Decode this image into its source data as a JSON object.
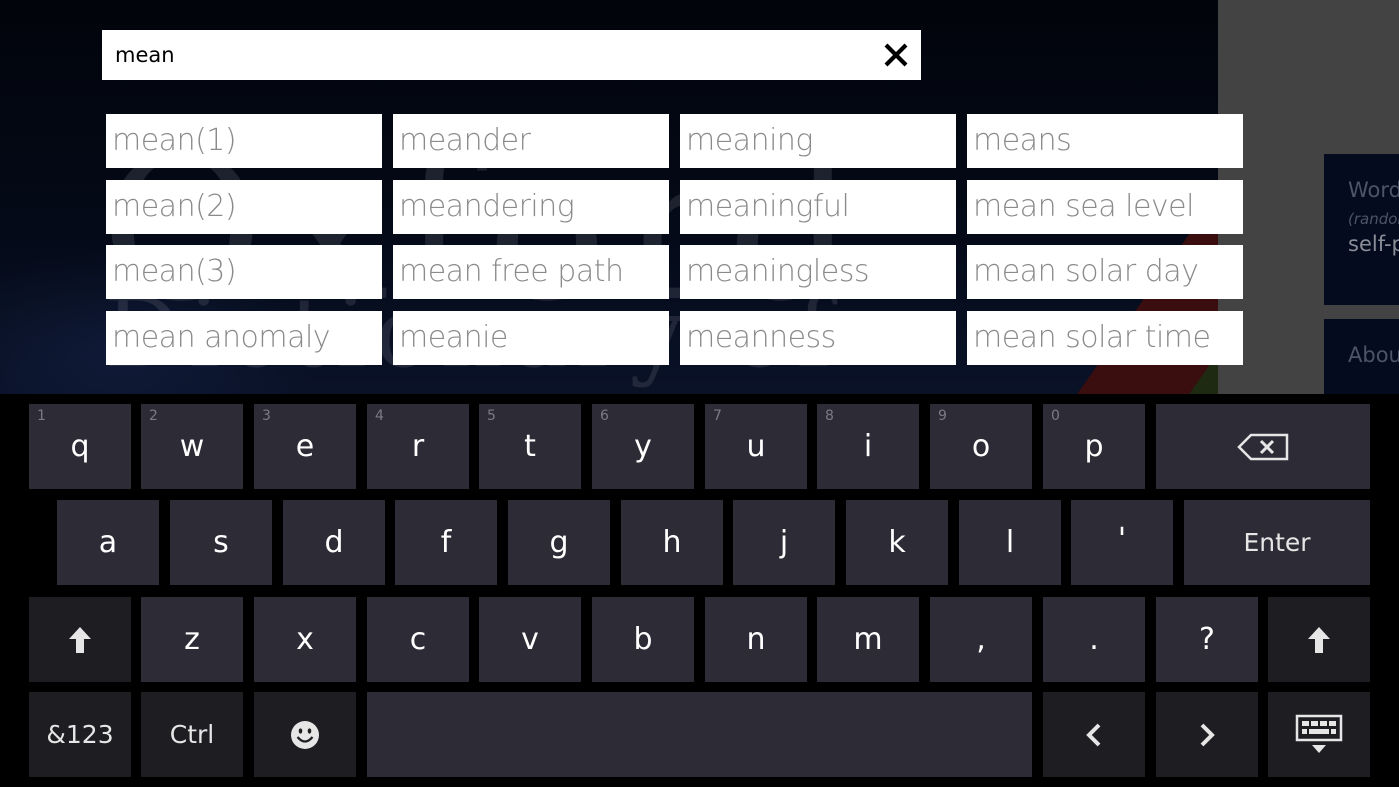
{
  "background": {
    "watermark_line1": "Oxford",
    "watermark_line2": "Dictionary of"
  },
  "side_panel": {
    "word_tile": {
      "title": "Word",
      "subtitle": "(random)",
      "word": "self-p"
    },
    "about_tile": {
      "title": "About"
    }
  },
  "search": {
    "value": "mean",
    "placeholder": "",
    "clear_icon": "close-icon"
  },
  "suggestions": [
    [
      "mean(1)",
      "meander",
      "meaning",
      "means"
    ],
    [
      "mean(2)",
      "meandering",
      "meaningful",
      "mean sea level"
    ],
    [
      "mean(3)",
      "mean free path",
      "meaningless",
      "mean solar day"
    ],
    [
      "mean anomaly",
      "meanie",
      "meanness",
      "mean solar time"
    ]
  ],
  "keyboard": {
    "row1": [
      {
        "label": "q",
        "hint": "1"
      },
      {
        "label": "w",
        "hint": "2"
      },
      {
        "label": "e",
        "hint": "3"
      },
      {
        "label": "r",
        "hint": "4"
      },
      {
        "label": "t",
        "hint": "5"
      },
      {
        "label": "y",
        "hint": "6"
      },
      {
        "label": "u",
        "hint": "7"
      },
      {
        "label": "i",
        "hint": "8"
      },
      {
        "label": "o",
        "hint": "9"
      },
      {
        "label": "p",
        "hint": "0"
      }
    ],
    "backspace_icon": "backspace-icon",
    "row2": [
      "a",
      "s",
      "d",
      "f",
      "g",
      "h",
      "j",
      "k",
      "l",
      "'"
    ],
    "enter_label": "Enter",
    "row3": [
      "z",
      "x",
      "c",
      "v",
      "b",
      "n",
      "m",
      ",",
      ".",
      "?"
    ],
    "shift_icon": "shift-arrow-icon",
    "symbols_label": "&123",
    "ctrl_label": "Ctrl",
    "emoji_icon": "smiley-icon",
    "left_arrow": "‹",
    "right_arrow": "›",
    "hide_keyboard_icon": "keyboard-hide-icon"
  }
}
